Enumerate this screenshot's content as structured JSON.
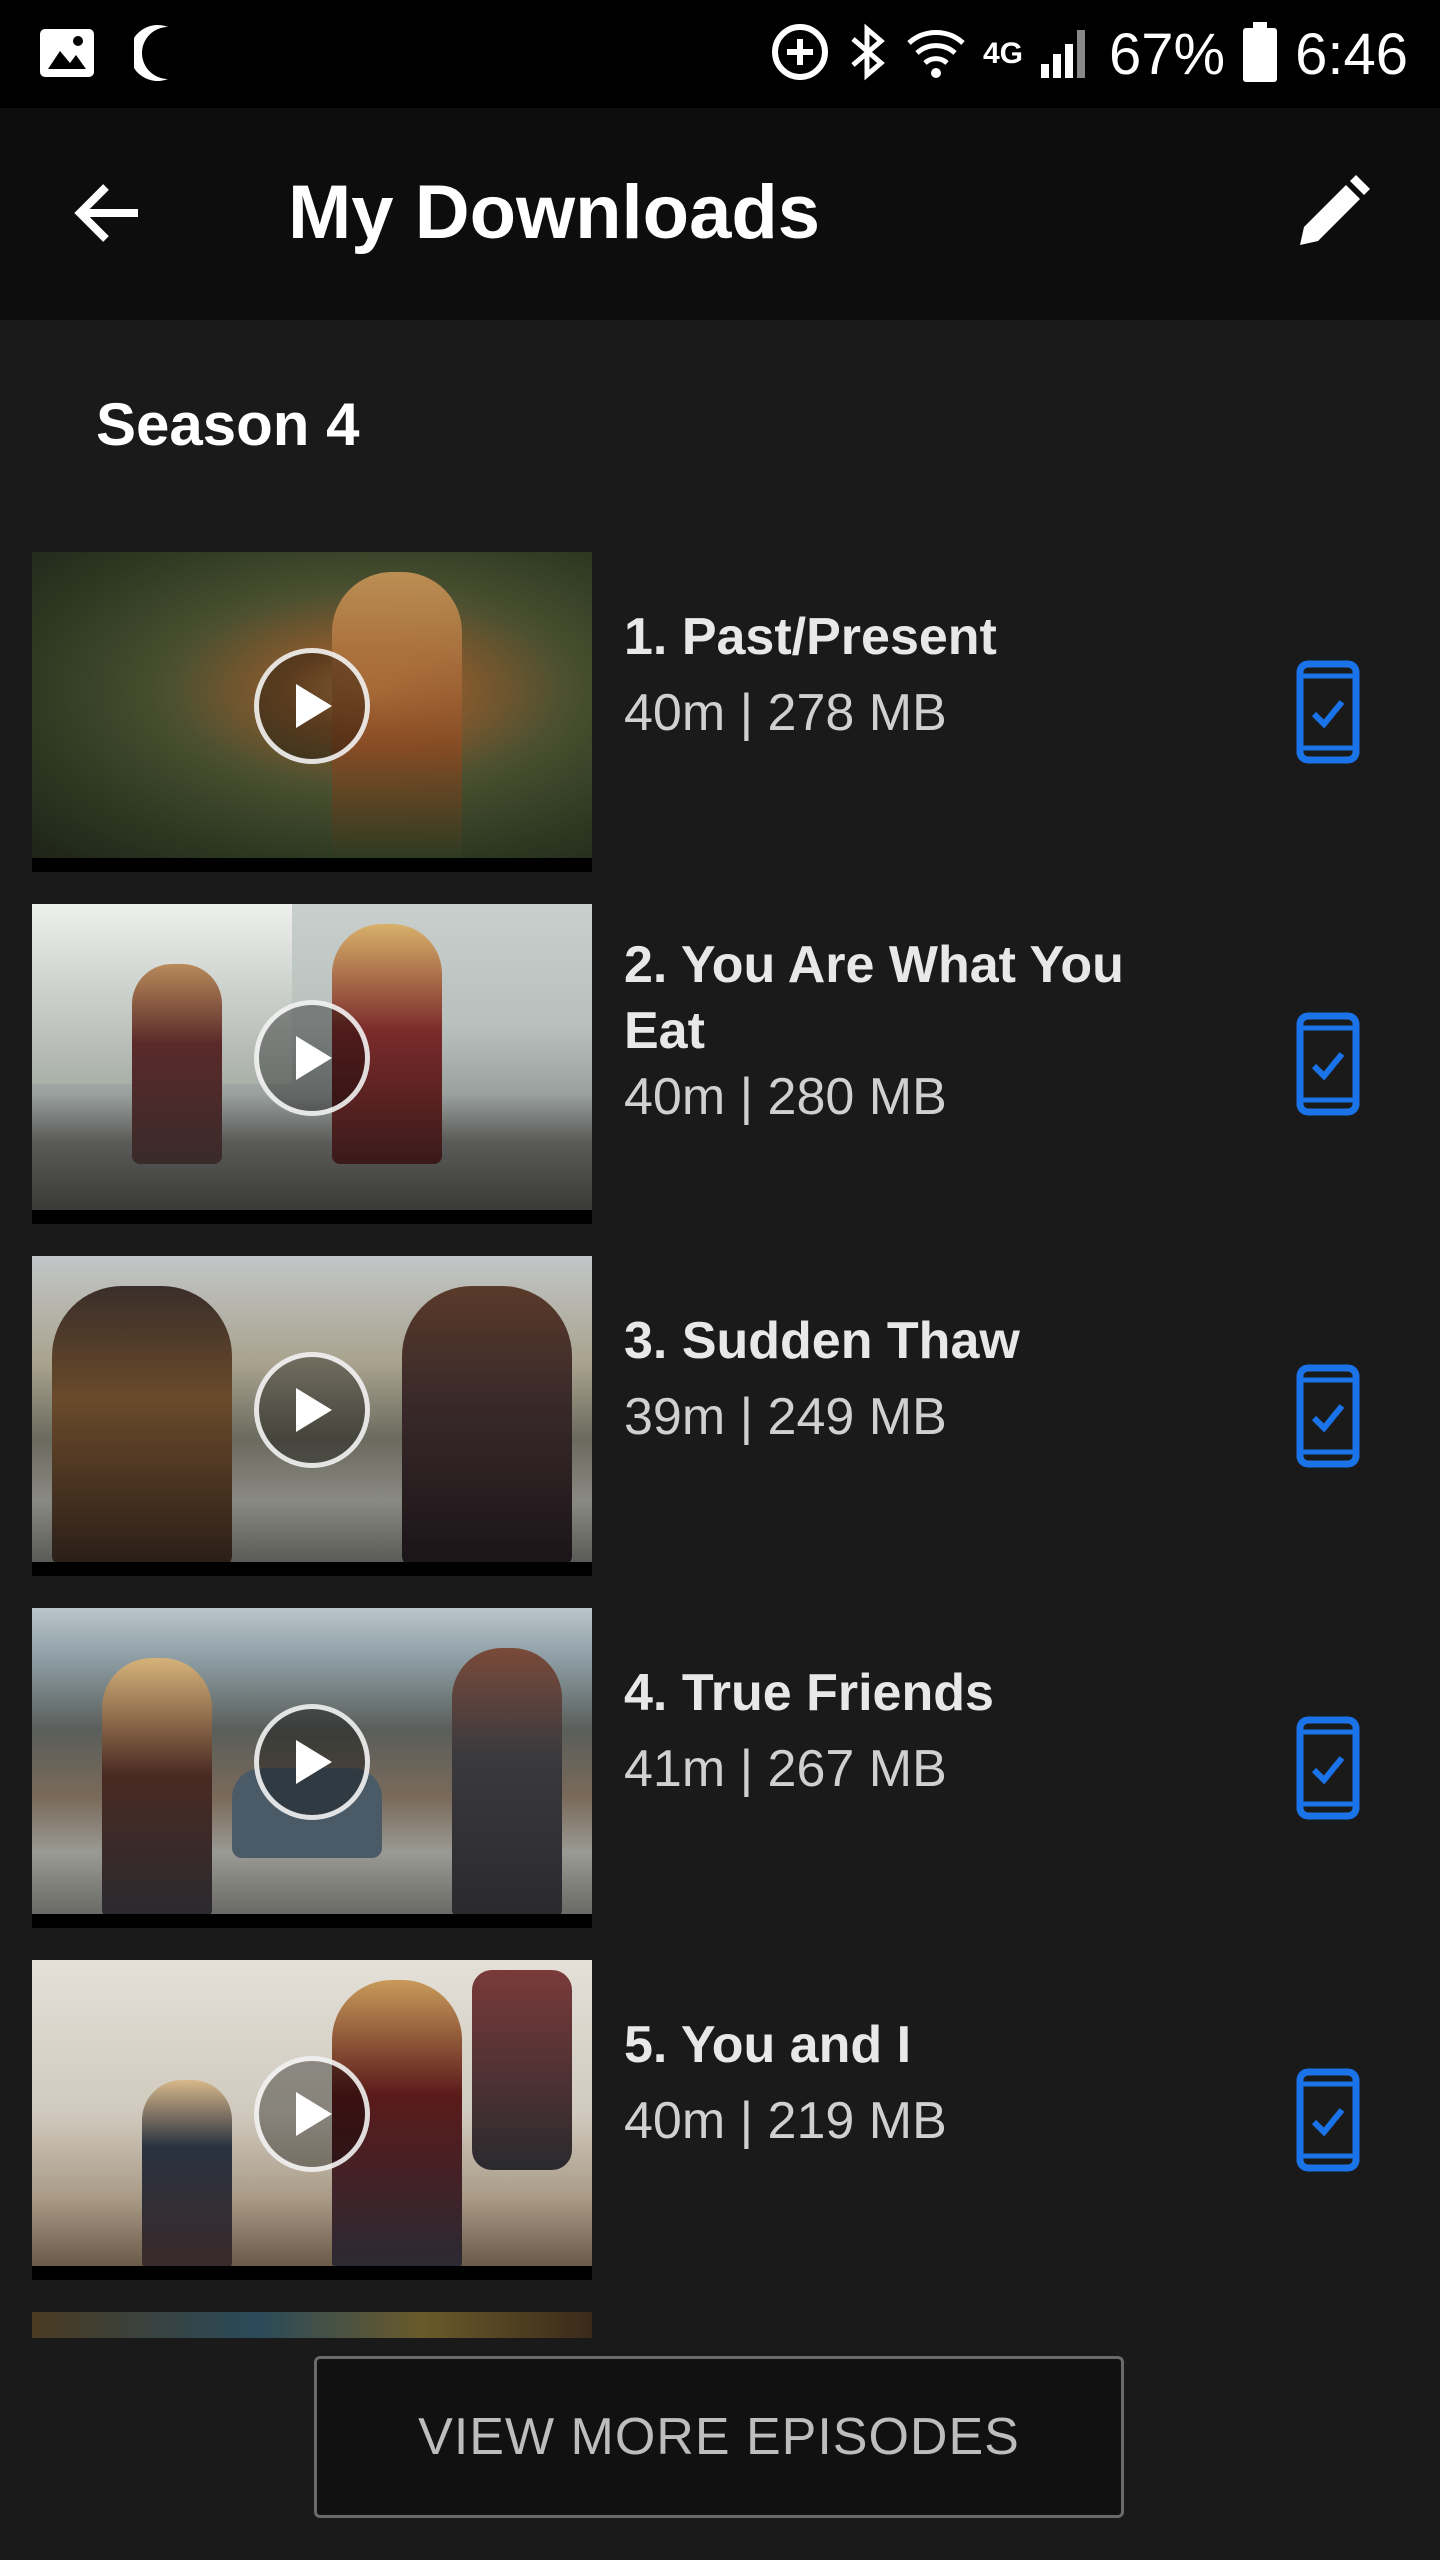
{
  "status_bar": {
    "battery": "67%",
    "time": "6:46",
    "network": "4G"
  },
  "app_bar": {
    "title": "My Downloads",
    "back_icon": "arrow-back-icon",
    "edit_icon": "pencil-icon"
  },
  "season": {
    "label": "Season 4"
  },
  "episodes": [
    {
      "title": "1. Past/Present",
      "meta": "40m | 278 MB"
    },
    {
      "title": "2. You Are What You Eat",
      "meta": "40m | 280 MB"
    },
    {
      "title": "3. Sudden Thaw",
      "meta": "39m | 249 MB"
    },
    {
      "title": "4. True Friends",
      "meta": "41m | 267 MB"
    },
    {
      "title": "5. You and I",
      "meta": "40m | 219 MB"
    }
  ],
  "footer": {
    "view_more_label": "VIEW MORE EPISODES"
  },
  "colors": {
    "accent": "#1a73e8",
    "background": "#1a1a1a",
    "app_bar": "#0d0d0d"
  }
}
